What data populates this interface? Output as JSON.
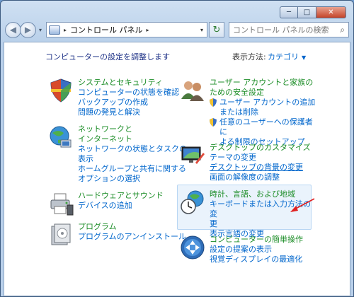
{
  "titlebar": {
    "minimize": "─",
    "maximize": "□",
    "close": "✕"
  },
  "address": {
    "icon": "control-panel-icon",
    "separator": "▸",
    "crumb": "コントロール パネル",
    "crumb_sep": "▸",
    "dropdown": "▾"
  },
  "search": {
    "placeholder": "コントロール パネルの検索"
  },
  "main": {
    "heading": "コンピューターの設定を調整します",
    "view_label": "表示方法:",
    "view_value": "カテゴリ"
  },
  "categories_left": [
    {
      "icon": "security-shield-icon",
      "title": "システムとセキュリティ",
      "links": [
        "コンピューターの状態を確認",
        "バックアップの作成",
        "問題の発見と解決"
      ]
    },
    {
      "icon": "network-globe-icon",
      "title": "ネットワークと\nインターネット",
      "links": [
        "ネットワークの状態とタスクの\n表示",
        "ホームグループと共有に関する\nオプションの選択"
      ]
    },
    {
      "icon": "printer-icon",
      "title": "ハードウェアとサウンド",
      "links": [
        "デバイスの追加"
      ]
    },
    {
      "icon": "programs-icon",
      "title": "プログラム",
      "links": [
        "プログラムのアンインストール"
      ]
    }
  ],
  "categories_right": [
    {
      "icon": "users-icon",
      "title": "ユーザー アカウントと家族の\nための安全設定",
      "links": [
        "ユーザー アカウントの追加\nまたは削除",
        "任意のユーザーへの保護者に\nよる制限のセットアップ"
      ]
    },
    {
      "icon": "desktop-personalize-icon",
      "title": "デスクトップのカスタマイズ",
      "links": [
        "テーマの変更",
        "デスクトップの背景の変更",
        "画面の解像度の調整"
      ]
    },
    {
      "icon": "clock-globe-icon",
      "title": "時計、言語、および地域",
      "links": [
        "キーボードまたは入力方法の変\n更",
        "表示言語の変更"
      ]
    },
    {
      "icon": "ease-of-access-icon",
      "title": "コンピューターの簡単操作",
      "links": [
        "設定の提案の表示",
        "視覚ディスプレイの最適化"
      ]
    }
  ],
  "colors": {
    "category_title": "#1a8c25",
    "link": "#0066cc",
    "heading": "#1e3287",
    "annotation_arrow": "#e02020"
  }
}
